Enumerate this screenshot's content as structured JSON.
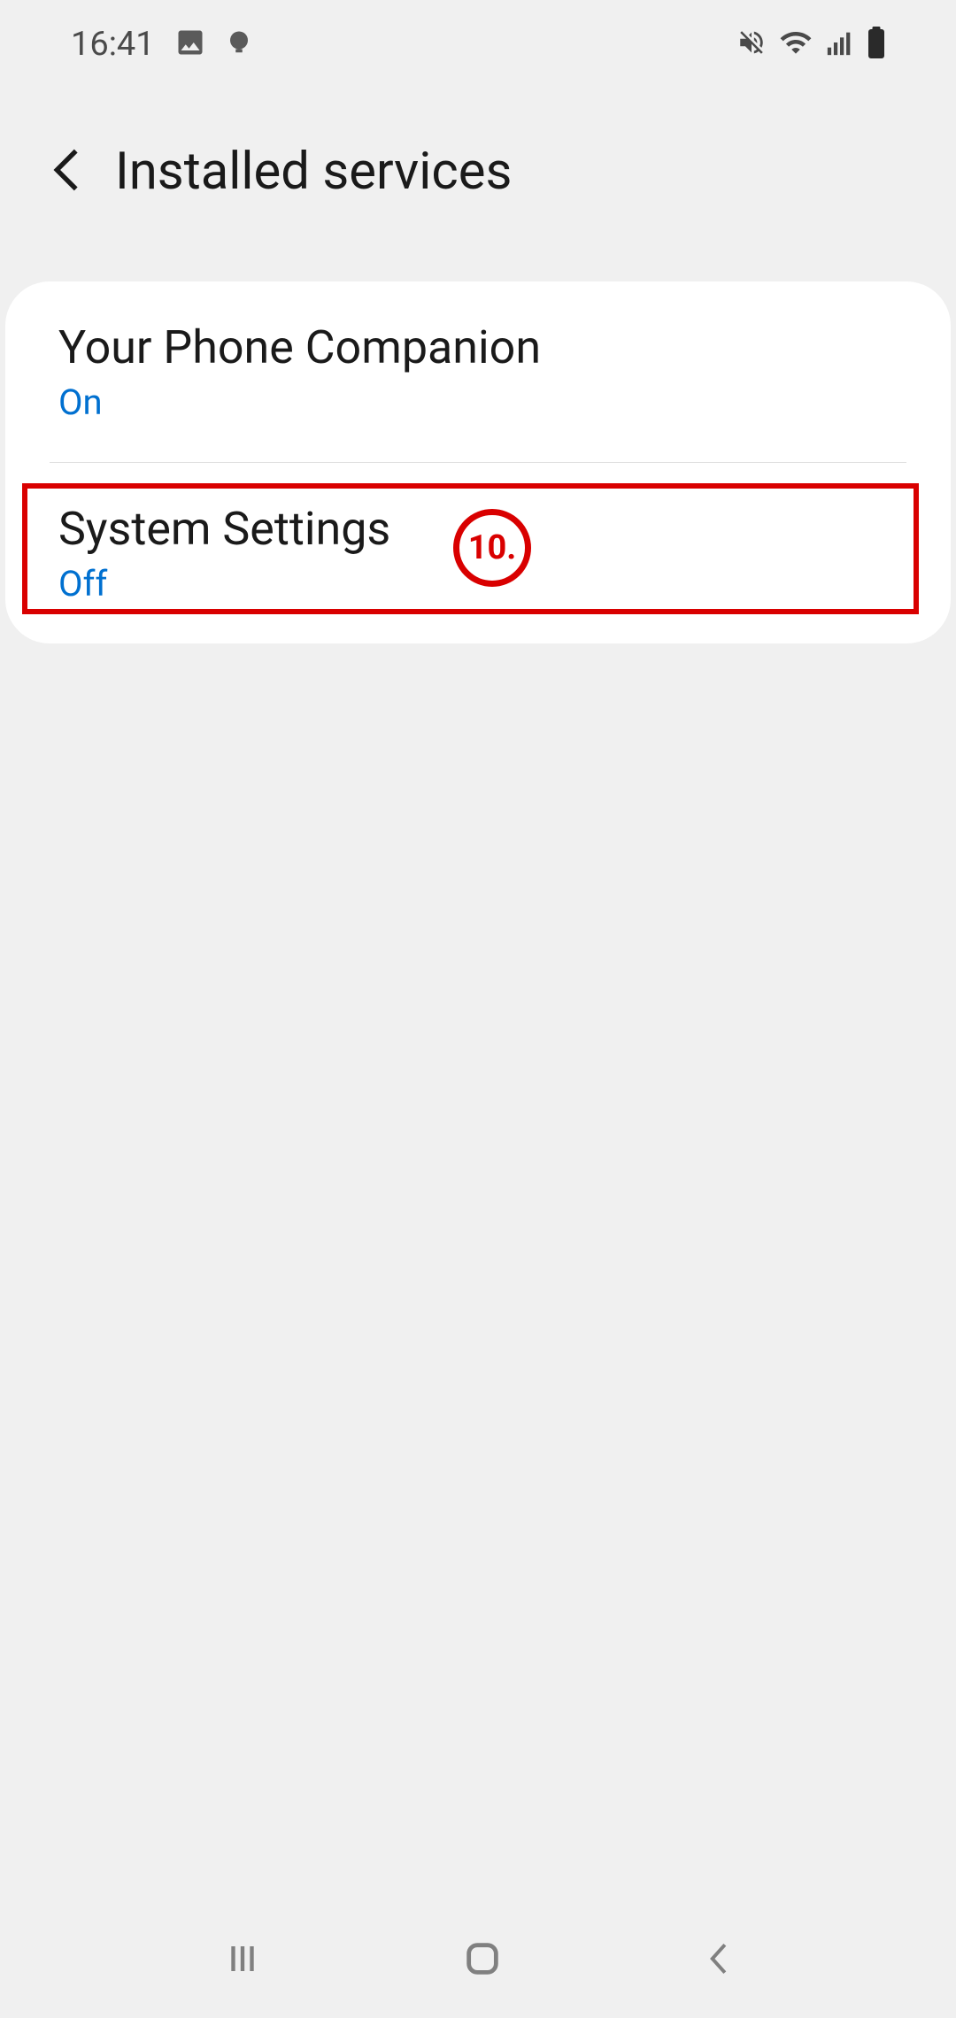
{
  "statusBar": {
    "time": "16:41"
  },
  "header": {
    "title": "Installed services"
  },
  "services": [
    {
      "title": "Your Phone Companion",
      "status": "On"
    },
    {
      "title": "System Settings",
      "status": "Off"
    }
  ],
  "annotation": {
    "label": "10."
  }
}
